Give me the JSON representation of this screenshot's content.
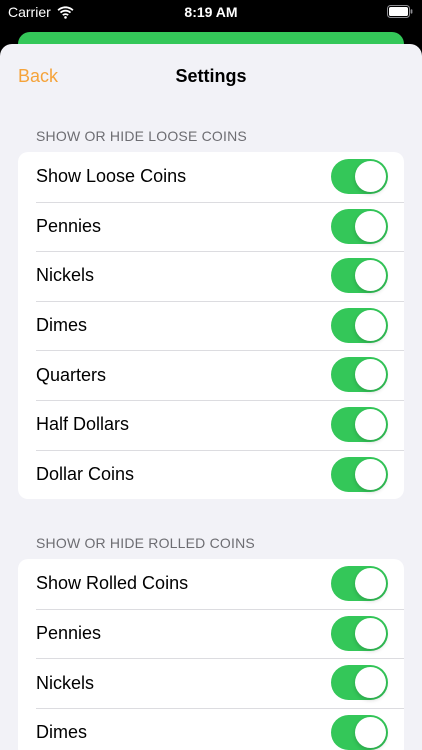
{
  "status_bar": {
    "carrier": "Carrier",
    "time": "8:19 AM"
  },
  "nav": {
    "back_label": "Back",
    "title": "Settings"
  },
  "colors": {
    "accent": "#f5a33a",
    "toggle_on": "#34c759",
    "background": "#f2f2f7"
  },
  "loose_coins": {
    "header": "SHOW OR HIDE LOOSE COINS",
    "items": [
      {
        "label": "Show Loose Coins",
        "on": true
      },
      {
        "label": "Pennies",
        "on": true
      },
      {
        "label": "Nickels",
        "on": true
      },
      {
        "label": "Dimes",
        "on": true
      },
      {
        "label": "Quarters",
        "on": true
      },
      {
        "label": "Half Dollars",
        "on": true
      },
      {
        "label": "Dollar Coins",
        "on": true
      }
    ]
  },
  "rolled_coins": {
    "header": "SHOW OR HIDE ROLLED COINS",
    "items": [
      {
        "label": "Show Rolled Coins",
        "on": true
      },
      {
        "label": "Pennies",
        "on": true
      },
      {
        "label": "Nickels",
        "on": true
      },
      {
        "label": "Dimes",
        "on": true
      }
    ]
  }
}
